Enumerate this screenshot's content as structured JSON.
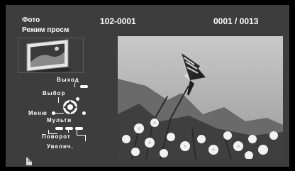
{
  "header": {
    "mode_label": "Фото",
    "view_mode": "Режим просм",
    "file_id": "102-0001",
    "counter": "0001 / 0013"
  },
  "controls": {
    "exit": "Выход",
    "select": "Выбор",
    "menu": "Меню",
    "multi": "Мульти",
    "rotate": "Поворот",
    "zoom": "Увелич."
  },
  "icons": {
    "thumbnail": "photo-frame-icon",
    "dpad": "dpad-icon",
    "file": "file-icon"
  },
  "colors": {
    "background": "#3d3d3d",
    "text": "#ffffff"
  }
}
